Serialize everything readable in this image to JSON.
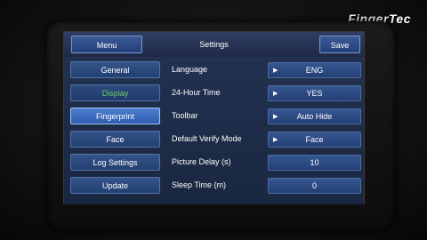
{
  "brand": "FingerTec",
  "header": {
    "menu_label": "Menu",
    "title": "Settings",
    "save_label": "Save"
  },
  "sidebar": {
    "items": [
      {
        "label": "General"
      },
      {
        "label": "Display"
      },
      {
        "label": "Fingerprint"
      },
      {
        "label": "Face"
      },
      {
        "label": "Log Settings"
      },
      {
        "label": "Update"
      }
    ]
  },
  "settings": {
    "rows": [
      {
        "label": "Language",
        "value": "ENG",
        "arrow": "▶"
      },
      {
        "label": "24-Hour Time",
        "value": "YES",
        "arrow": "▶"
      },
      {
        "label": "Toolbar",
        "value": "Auto Hide",
        "arrow": "▶"
      },
      {
        "label": "Default Verify Mode",
        "value": "Face",
        "arrow": "▶"
      },
      {
        "label": "Picture Delay (s)",
        "value": "10"
      },
      {
        "label": "Sleep Time (m)",
        "value": "0"
      }
    ]
  },
  "colors": {
    "selected_text": "#6fd05a",
    "panel": "#21314f",
    "button": "#2b4a80"
  }
}
